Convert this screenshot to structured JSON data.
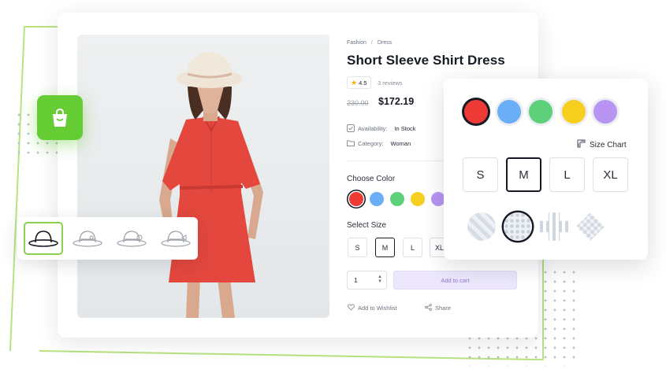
{
  "product": {
    "breadcrumb": [
      "Fashion",
      "Dress"
    ],
    "breadcrumb_sep": "/",
    "title": "Short Sleeve Shirt Dress",
    "rating": "4.5",
    "reviews": "3 reviews",
    "old_price": "230.00",
    "price": "$172.19",
    "availability_label": "Availability:",
    "availability_value": "In Stock",
    "category_label": "Category:",
    "category_value": "Woman"
  },
  "color": {
    "label": "Choose Color",
    "swatches": [
      {
        "name": "red",
        "hex": "#ef3b36"
      },
      {
        "name": "blue",
        "hex": "#6aaef7"
      },
      {
        "name": "green",
        "hex": "#5cd17a"
      },
      {
        "name": "yellow",
        "hex": "#f7cf1f"
      },
      {
        "name": "purple",
        "hex": "#b895f2"
      }
    ],
    "selected": "red"
  },
  "size": {
    "label": "Select Size",
    "options": [
      "S",
      "M",
      "L",
      "XL"
    ],
    "selected": "M"
  },
  "cart": {
    "quantity": "1",
    "add_label": "Add to cart",
    "wishlist_label": "Add to Wishlist",
    "share_label": "Share"
  },
  "popup": {
    "size_chart_label": "Size Chart",
    "sizes": [
      "S",
      "M",
      "L",
      "XL"
    ],
    "selected_size": "M",
    "patterns": [
      "diamond-pattern",
      "hexagon-pattern",
      "knot-pattern",
      "checker-pattern"
    ],
    "selected_pattern": "hexagon-pattern"
  },
  "hats": {
    "items": [
      "hat-plain",
      "hat-bow",
      "hat-flower",
      "hat-ribbon"
    ],
    "selected": "hat-plain"
  },
  "icons": {
    "bag": "shopping-bag-icon",
    "star": "star-icon",
    "availability": "checkbox-icon",
    "category": "folder-icon",
    "wishlist": "heart-icon",
    "share": "share-icon",
    "size_chart": "ruler-icon"
  },
  "colors": {
    "accent_green": "#66cc33",
    "frame_line": "#b9e27f",
    "cart_button_bg": "#ece7fb",
    "cart_button_text": "#8c7ad6",
    "dark": "#161a25"
  }
}
